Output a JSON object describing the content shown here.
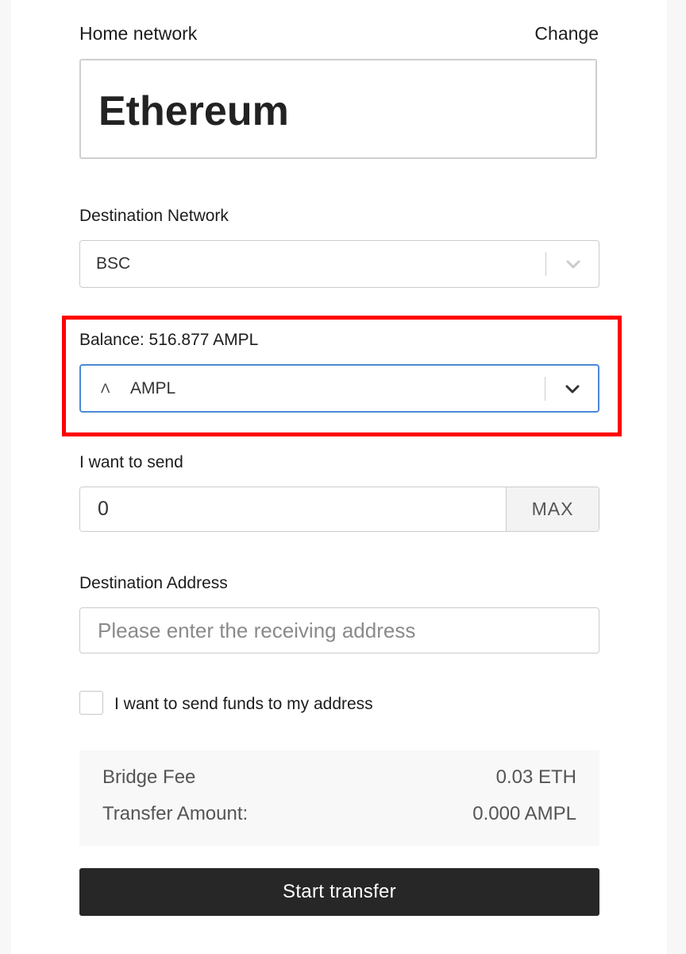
{
  "home_network": {
    "label": "Home network",
    "change_label": "Change",
    "value": "Ethereum"
  },
  "destination_network": {
    "label": "Destination Network",
    "selected": "BSC"
  },
  "token": {
    "balance_label": "Balance: 516.877 AMPL",
    "icon_glyph": "Λ",
    "selected": "AMPL"
  },
  "amount": {
    "label": "I want to send",
    "value": "0",
    "max_label": "MAX"
  },
  "destination_address": {
    "label": "Destination Address",
    "placeholder": "Please enter the receiving address"
  },
  "self_address_checkbox": {
    "label": "I want to send funds to my address",
    "checked": false
  },
  "summary": {
    "bridge_fee_label": "Bridge Fee",
    "bridge_fee_value": "0.03 ETH",
    "transfer_amount_label": "Transfer Amount:",
    "transfer_amount_value": "0.000 AMPL"
  },
  "start_button_label": "Start transfer",
  "colors": {
    "highlight": "#ff0000",
    "focus_border": "#4a8ad6",
    "button_bg": "#272727"
  }
}
